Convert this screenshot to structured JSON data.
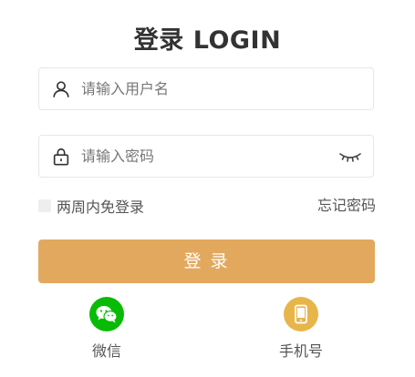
{
  "title": "登录 LOGIN",
  "username": {
    "icon": "user-icon",
    "placeholder": "请输入用户名",
    "value": ""
  },
  "password": {
    "icon": "lock-icon",
    "placeholder": "请输入密码",
    "value": "",
    "toggle_icon": "eye-closed-icon"
  },
  "remember": {
    "label": "两周内免登录",
    "checked": false
  },
  "forgot_label": "忘记密码",
  "login_button_label": "登 录",
  "alt_logins": [
    {
      "label": "微信",
      "icon": "wechat-icon",
      "color": "#09bb07"
    },
    {
      "label": "手机号",
      "icon": "phone-icon",
      "color": "#e8b54a"
    }
  ],
  "colors": {
    "accent": "#e2a95e",
    "wechat": "#09bb07",
    "phone": "#e8b54a"
  }
}
